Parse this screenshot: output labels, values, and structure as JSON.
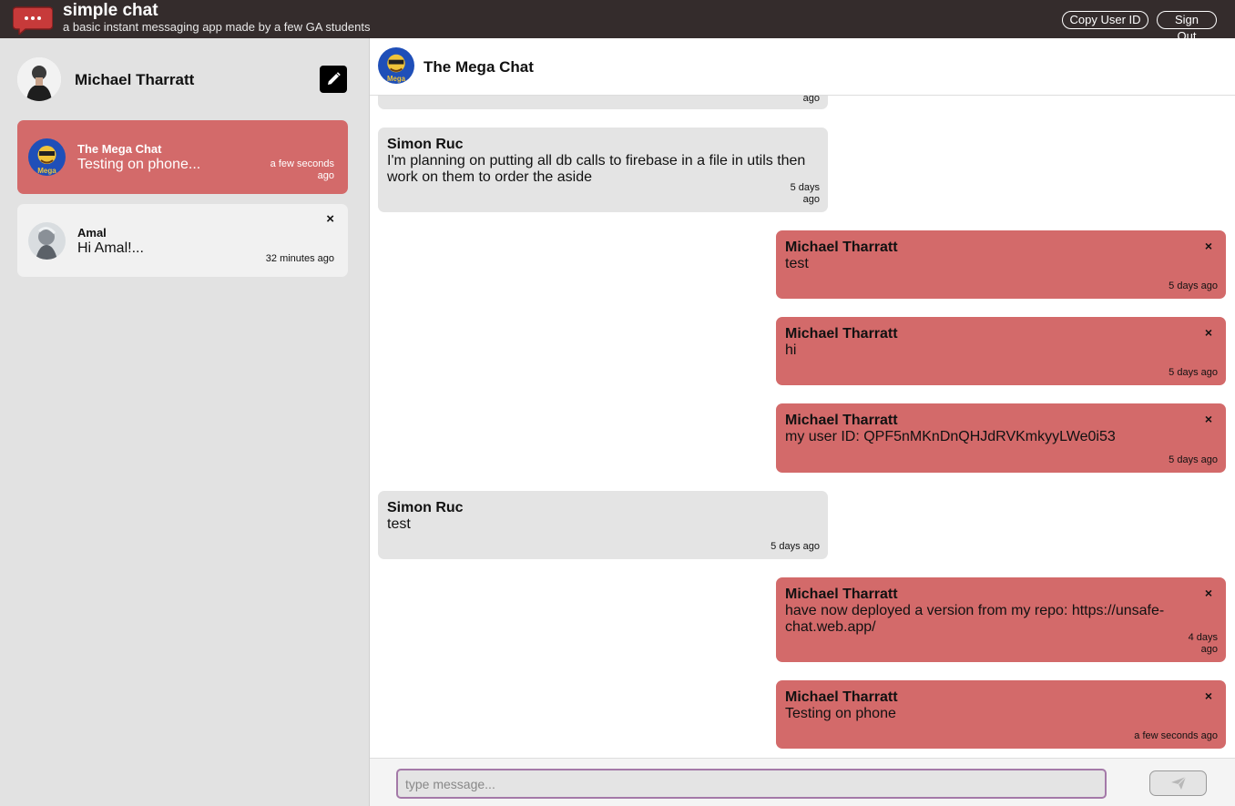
{
  "header": {
    "title": "simple chat",
    "subtitle": "a basic instant messaging app made by a few GA students",
    "copy_user_id_label": "Copy User ID",
    "sign_out_label": "Sign Out"
  },
  "sidebar": {
    "user_name": "Michael Tharratt",
    "conversations": [
      {
        "name": "The Mega Chat",
        "preview": "Testing on phone...",
        "time": "a few seconds ago",
        "active": true
      },
      {
        "name": "Amal",
        "preview": "Hi Amal!...",
        "time": "32 minutes ago",
        "close_symbol": "×"
      }
    ]
  },
  "chat": {
    "title": "The Mega Chat",
    "partial_top_time": "ago",
    "messages": [
      {
        "sender": "Simon Ruc",
        "text": "I'm planning on putting all db calls to firebase in a file in utils then work on them to order the aside",
        "time": "5 days ago",
        "mine": false
      },
      {
        "sender": "Michael Tharratt",
        "text": "test",
        "time": "5 days ago",
        "mine": true
      },
      {
        "sender": "Michael Tharratt",
        "text": "hi",
        "time": "5 days ago",
        "mine": true
      },
      {
        "sender": "Michael Tharratt",
        "text": "my user ID: QPF5nMKnDnQHJdRVKmkyyLWe0i53",
        "time": "5 days ago",
        "mine": true
      },
      {
        "sender": "Simon Ruc",
        "text": "test",
        "time": "5 days ago",
        "mine": false
      },
      {
        "sender": "Michael Tharratt",
        "text": "have now deployed a version from my repo: https://unsafe-chat.web.app/",
        "time": "4 days ago",
        "mine": true
      },
      {
        "sender": "Michael Tharratt",
        "text": "Testing on phone",
        "time": "a few seconds ago",
        "mine": true
      }
    ],
    "close_symbol": "×"
  },
  "compose": {
    "placeholder": "type message...",
    "value": ""
  },
  "colors": {
    "header_bg": "#342c2c",
    "accent": "#d36a6a",
    "sidebar_bg": "#e2e2e2",
    "bubble_other": "#e4e4e4",
    "input_border": "#a479a8"
  }
}
